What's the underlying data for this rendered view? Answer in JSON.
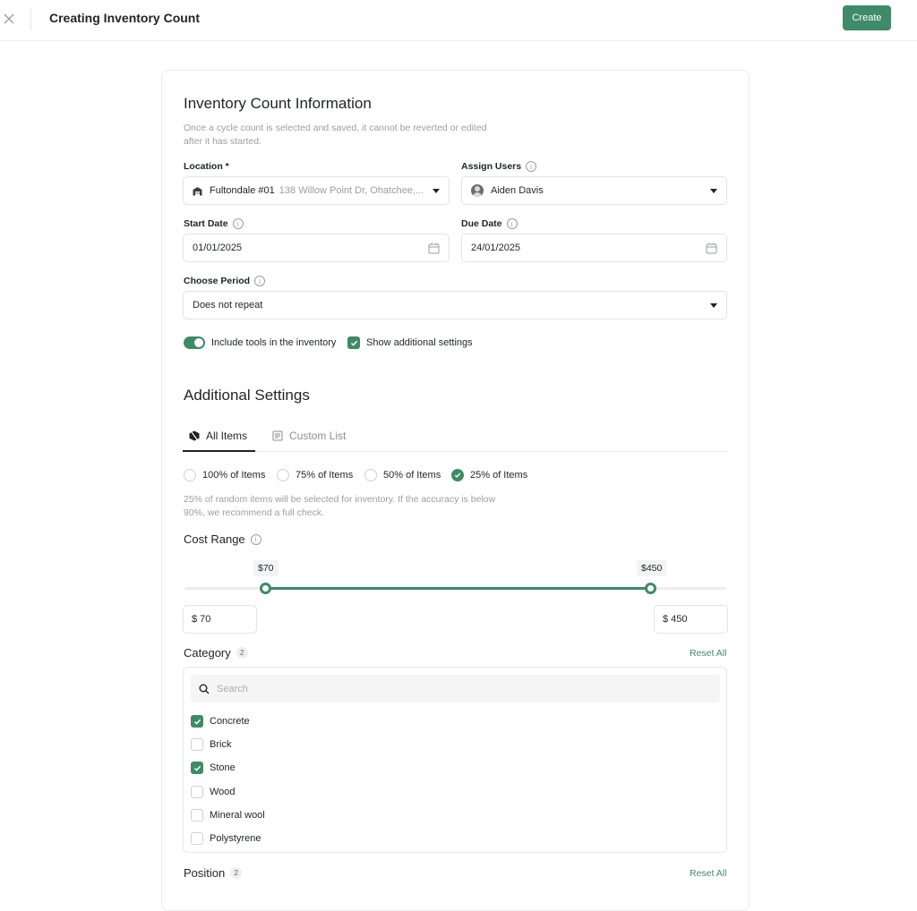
{
  "header": {
    "title": "Creating Inventory Count",
    "create_label": "Create"
  },
  "info": {
    "title": "Inventory Count Information",
    "desc_line1": "Once a cycle count is selected and saved, it cannot be reverted or edited",
    "desc_line2": "after it has started.",
    "location_label": "Location *",
    "location_name": "Fultondale #01",
    "location_address": "138 Willow Point Dr, Ohatchee,...",
    "assign_users_label": "Assign Users",
    "assigned_user": "Aiden Davis",
    "start_date_label": "Start Date",
    "start_date": "01/01/2025",
    "due_date_label": "Due Date",
    "due_date": "24/01/2025",
    "period_label": "Choose Period",
    "period_value": "Does not repeat",
    "include_tools_label": "Include tools in the inventory",
    "include_tools_on": true,
    "show_additional_label": "Show additional settings",
    "show_additional_checked": true
  },
  "additional": {
    "title": "Additional Settings",
    "tabs": [
      {
        "label": "All Items",
        "active": true,
        "icon": "box-icon"
      },
      {
        "label": "Custom List",
        "active": false,
        "icon": "list-icon"
      }
    ],
    "percent_options": [
      {
        "label": "100% of Items",
        "checked": false
      },
      {
        "label": "75% of Items",
        "checked": false
      },
      {
        "label": "50% of Items",
        "checked": false
      },
      {
        "label": "25% of Items",
        "checked": true
      }
    ],
    "percent_desc_line1": "25% of random items will be selected for inventory. If the accuracy is below",
    "percent_desc_line2": "90%, we recommend a full check.",
    "cost_range_label": "Cost Range",
    "cost_min_tip": "$70",
    "cost_max_tip": "$450",
    "cost_min_field": "$ 70",
    "cost_max_field": "$ 450",
    "cost_min_fraction": 0.15,
    "cost_max_fraction": 0.86
  },
  "category": {
    "label": "Category",
    "count": "2",
    "reset_label": "Reset All",
    "search_placeholder": "Search",
    "items": [
      {
        "label": "Concrete",
        "checked": true
      },
      {
        "label": "Brick",
        "checked": false
      },
      {
        "label": "Stone",
        "checked": true
      },
      {
        "label": "Wood",
        "checked": false
      },
      {
        "label": "Mineral wool",
        "checked": false
      },
      {
        "label": "Polystyrene",
        "checked": false
      }
    ]
  },
  "position": {
    "label": "Position",
    "count": "2",
    "reset_label": "Reset All"
  },
  "colors": {
    "accent": "#3f8a68",
    "text": "#1f2328",
    "muted": "#9a9ea3"
  }
}
